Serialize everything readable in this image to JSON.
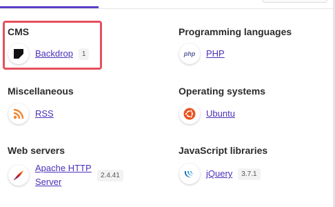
{
  "categories": {
    "cms": {
      "title": "CMS",
      "item": {
        "name": "Backdrop",
        "version": "1",
        "icon": "backdrop-icon"
      }
    },
    "programming": {
      "title": "Programming languages",
      "item": {
        "name": "PHP",
        "icon": "php-icon"
      }
    },
    "misc": {
      "title": "Miscellaneous",
      "item": {
        "name": "RSS",
        "icon": "rss-icon"
      }
    },
    "os": {
      "title": "Operating systems",
      "item": {
        "name": "Ubuntu",
        "icon": "ubuntu-icon"
      }
    },
    "web": {
      "title": "Web servers",
      "item": {
        "name": "Apache HTTP Server",
        "version": "2.4.41",
        "icon": "apache-feather-icon"
      }
    },
    "js": {
      "title": "JavaScript libraries",
      "item": {
        "name": "jQuery",
        "version": "3.7.1",
        "icon": "jquery-icon"
      }
    }
  },
  "colors": {
    "accent": "#5c3fc6",
    "link": "#4b2fb8",
    "highlight": "#e5505d",
    "rss": "#f5822a",
    "ubuntu": "#e95420",
    "php": "#5a5f9a",
    "jquery": "#0d6fb8"
  }
}
